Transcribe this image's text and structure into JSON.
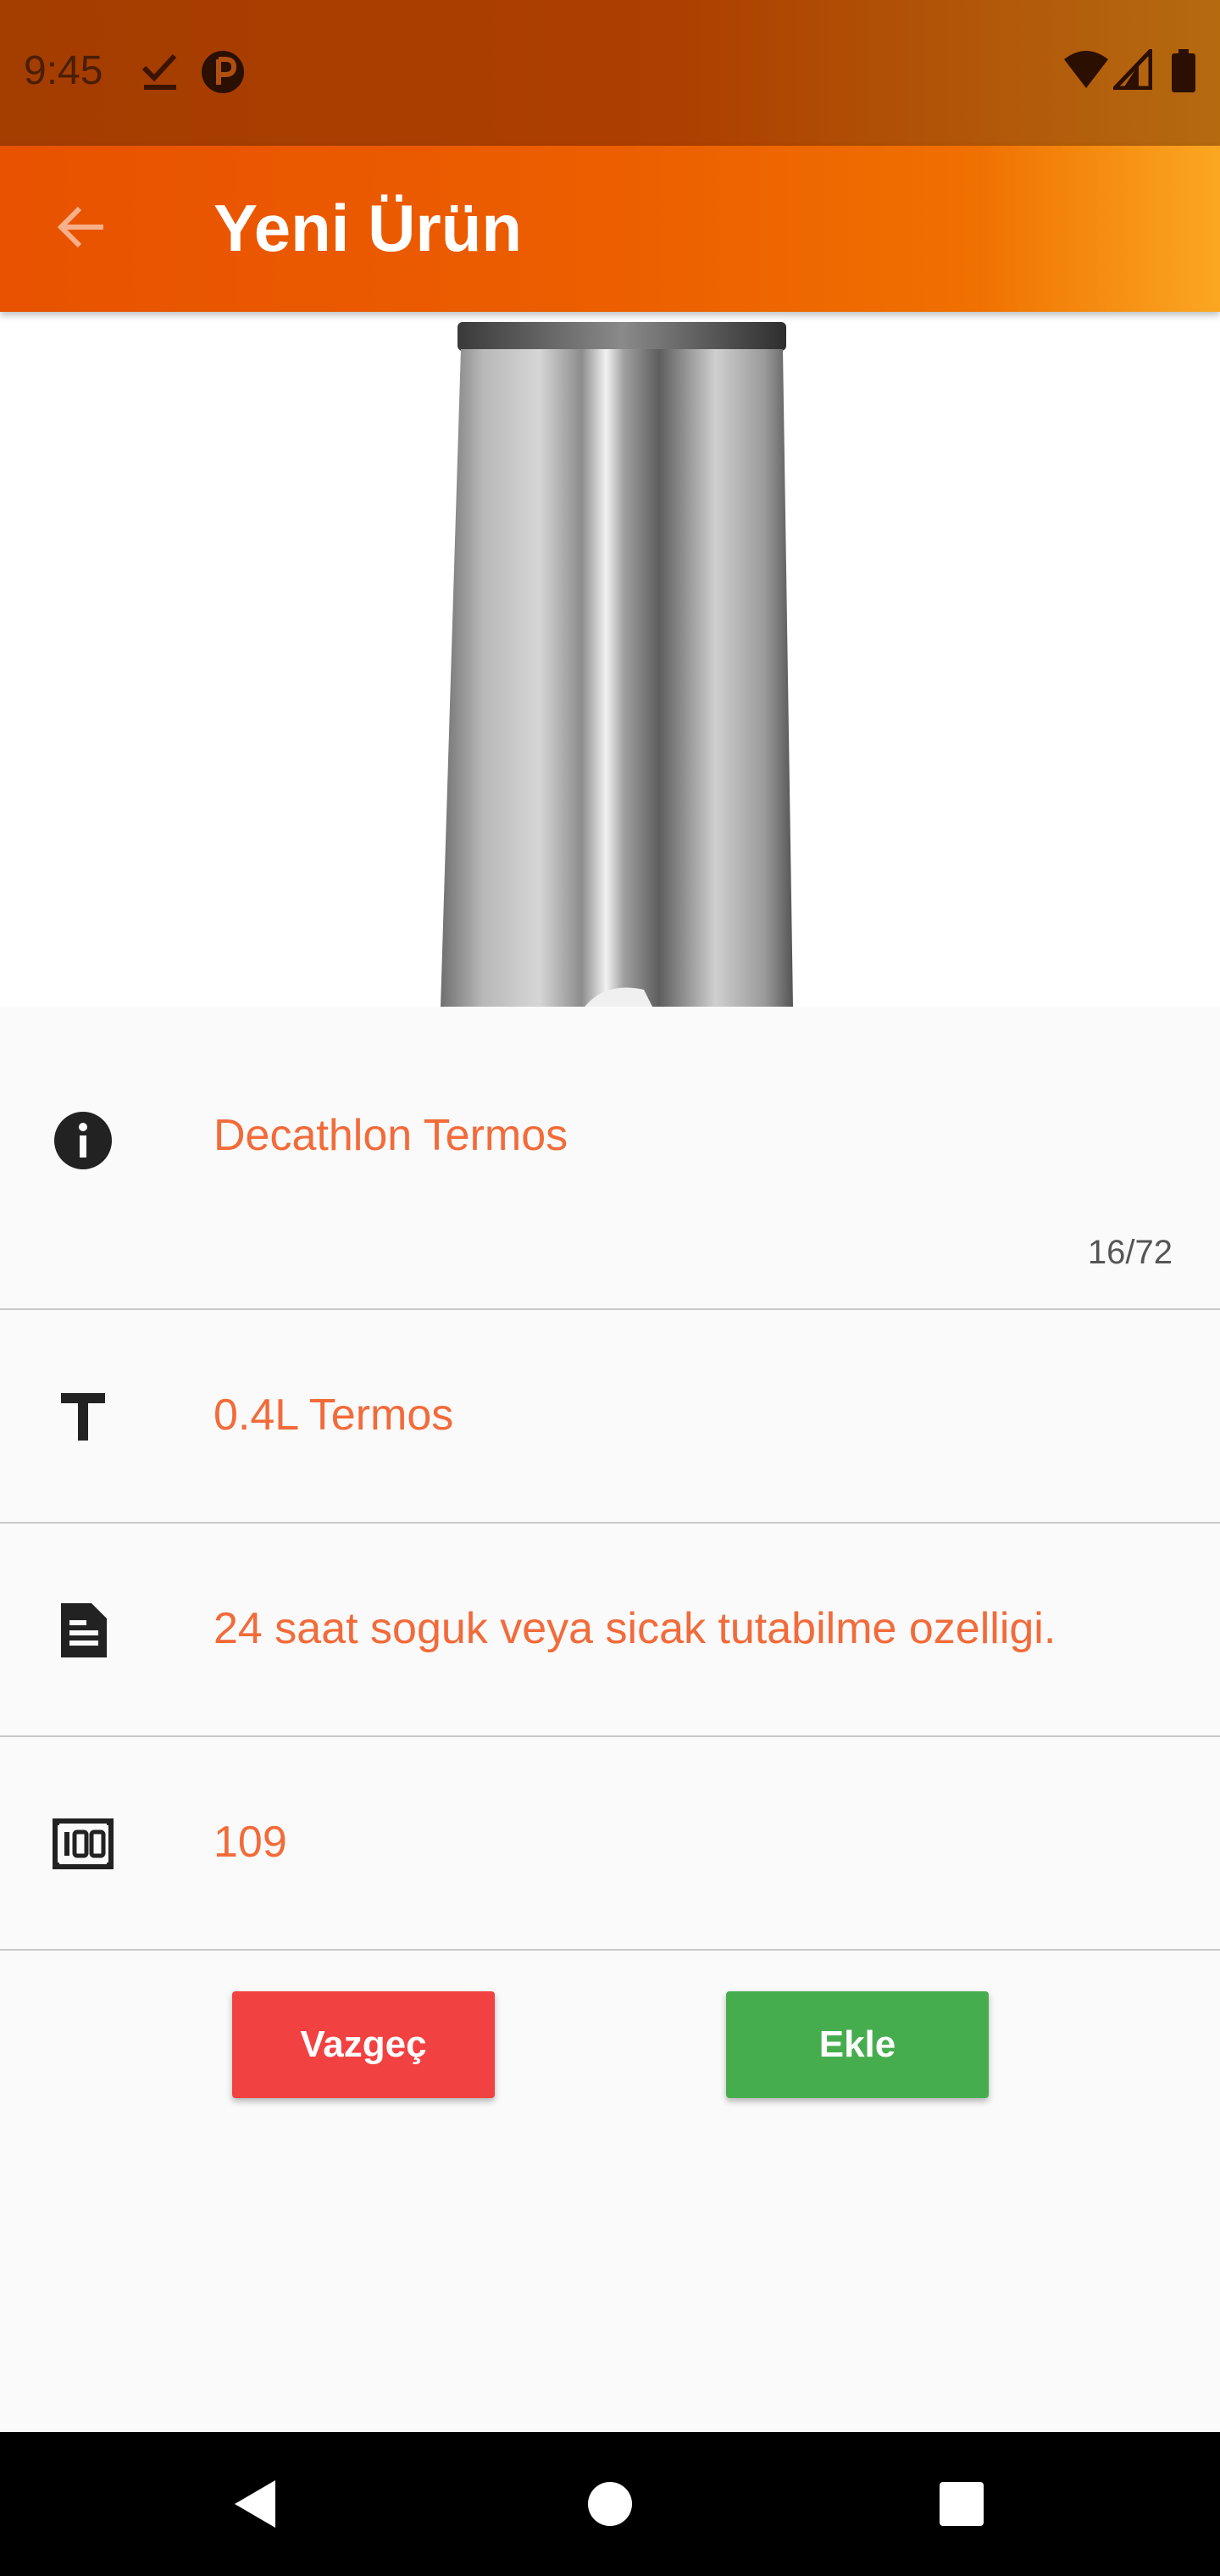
{
  "status_bar": {
    "time": "9:45",
    "icons": [
      "check-download-icon",
      "app-badge-icon",
      "wifi-icon",
      "cell-signal-icon",
      "battery-icon"
    ]
  },
  "app_bar": {
    "title": "Yeni Ürün",
    "back_icon": "arrow-back-icon",
    "gradient_colors": [
      "#e85200",
      "#fba722"
    ]
  },
  "product": {
    "image": "thermos-image"
  },
  "form": {
    "name": {
      "icon": "info-icon",
      "value": "Decathlon Termos",
      "counter": "16/72"
    },
    "title": {
      "icon": "text-format-icon",
      "value": "0.4L Termos"
    },
    "description": {
      "icon": "description-icon",
      "value": "24 saat soguk veya sicak tutabilme ozelligi."
    },
    "price": {
      "icon": "barcode-100-icon",
      "value": "109"
    },
    "value_color": "#f26b3a"
  },
  "actions": {
    "cancel_label": "Vazgeç",
    "add_label": "Ekle",
    "cancel_color": "#f24141",
    "add_color": "#46ad4f"
  },
  "nav_bar": {
    "icons": [
      "back-triangle-icon",
      "home-circle-icon",
      "recents-square-icon"
    ]
  }
}
